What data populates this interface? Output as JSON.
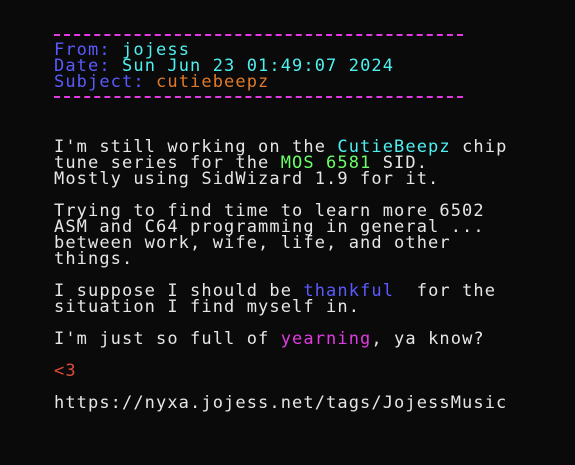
{
  "header": {
    "from_label": "From:",
    "from_value": "jojess",
    "date_label": "Date:",
    "date_value": "Sun Jun 23 01:49:07 2024",
    "subject_label": "Subject:",
    "subject_value": "cutiebeepz"
  },
  "body": {
    "p1": {
      "l1_a": "I'm still working on the ",
      "l1_link": "CutieBeepz",
      "l1_b": " chip",
      "l2_a": "tune series for the ",
      "l2_hl": "MOS 6581",
      "l2_b": " SID.",
      "l3": "Mostly using SidWizard 1.9 for it."
    },
    "p2": {
      "l1": "Trying to find time to learn more 6502",
      "l2": "ASM and C64 programming in general ...",
      "l3": "between work, wife, life, and other",
      "l4": "things."
    },
    "p3": {
      "l1_a": "I suppose I should be ",
      "l1_hl": "thankful",
      "l1_b": "  for the",
      "l2": "situation I find myself in."
    },
    "p4": {
      "a": "I'm just so full of ",
      "hl": "yearning",
      "b": ", ya know?"
    },
    "heart": "<3",
    "url": "https://nyxa.jojess.net/tags/JojessMusic"
  },
  "colors": {
    "background": "#0a0a0a",
    "rule": "#e03ae0",
    "label_blue": "#5a5aff",
    "value_cyan": "#4ef0f0",
    "subject_orange": "#e07a2a",
    "highlight_green": "#6aff6a",
    "highlight_magenta": "#e03ae0",
    "heart_red": "#e04a3a"
  }
}
